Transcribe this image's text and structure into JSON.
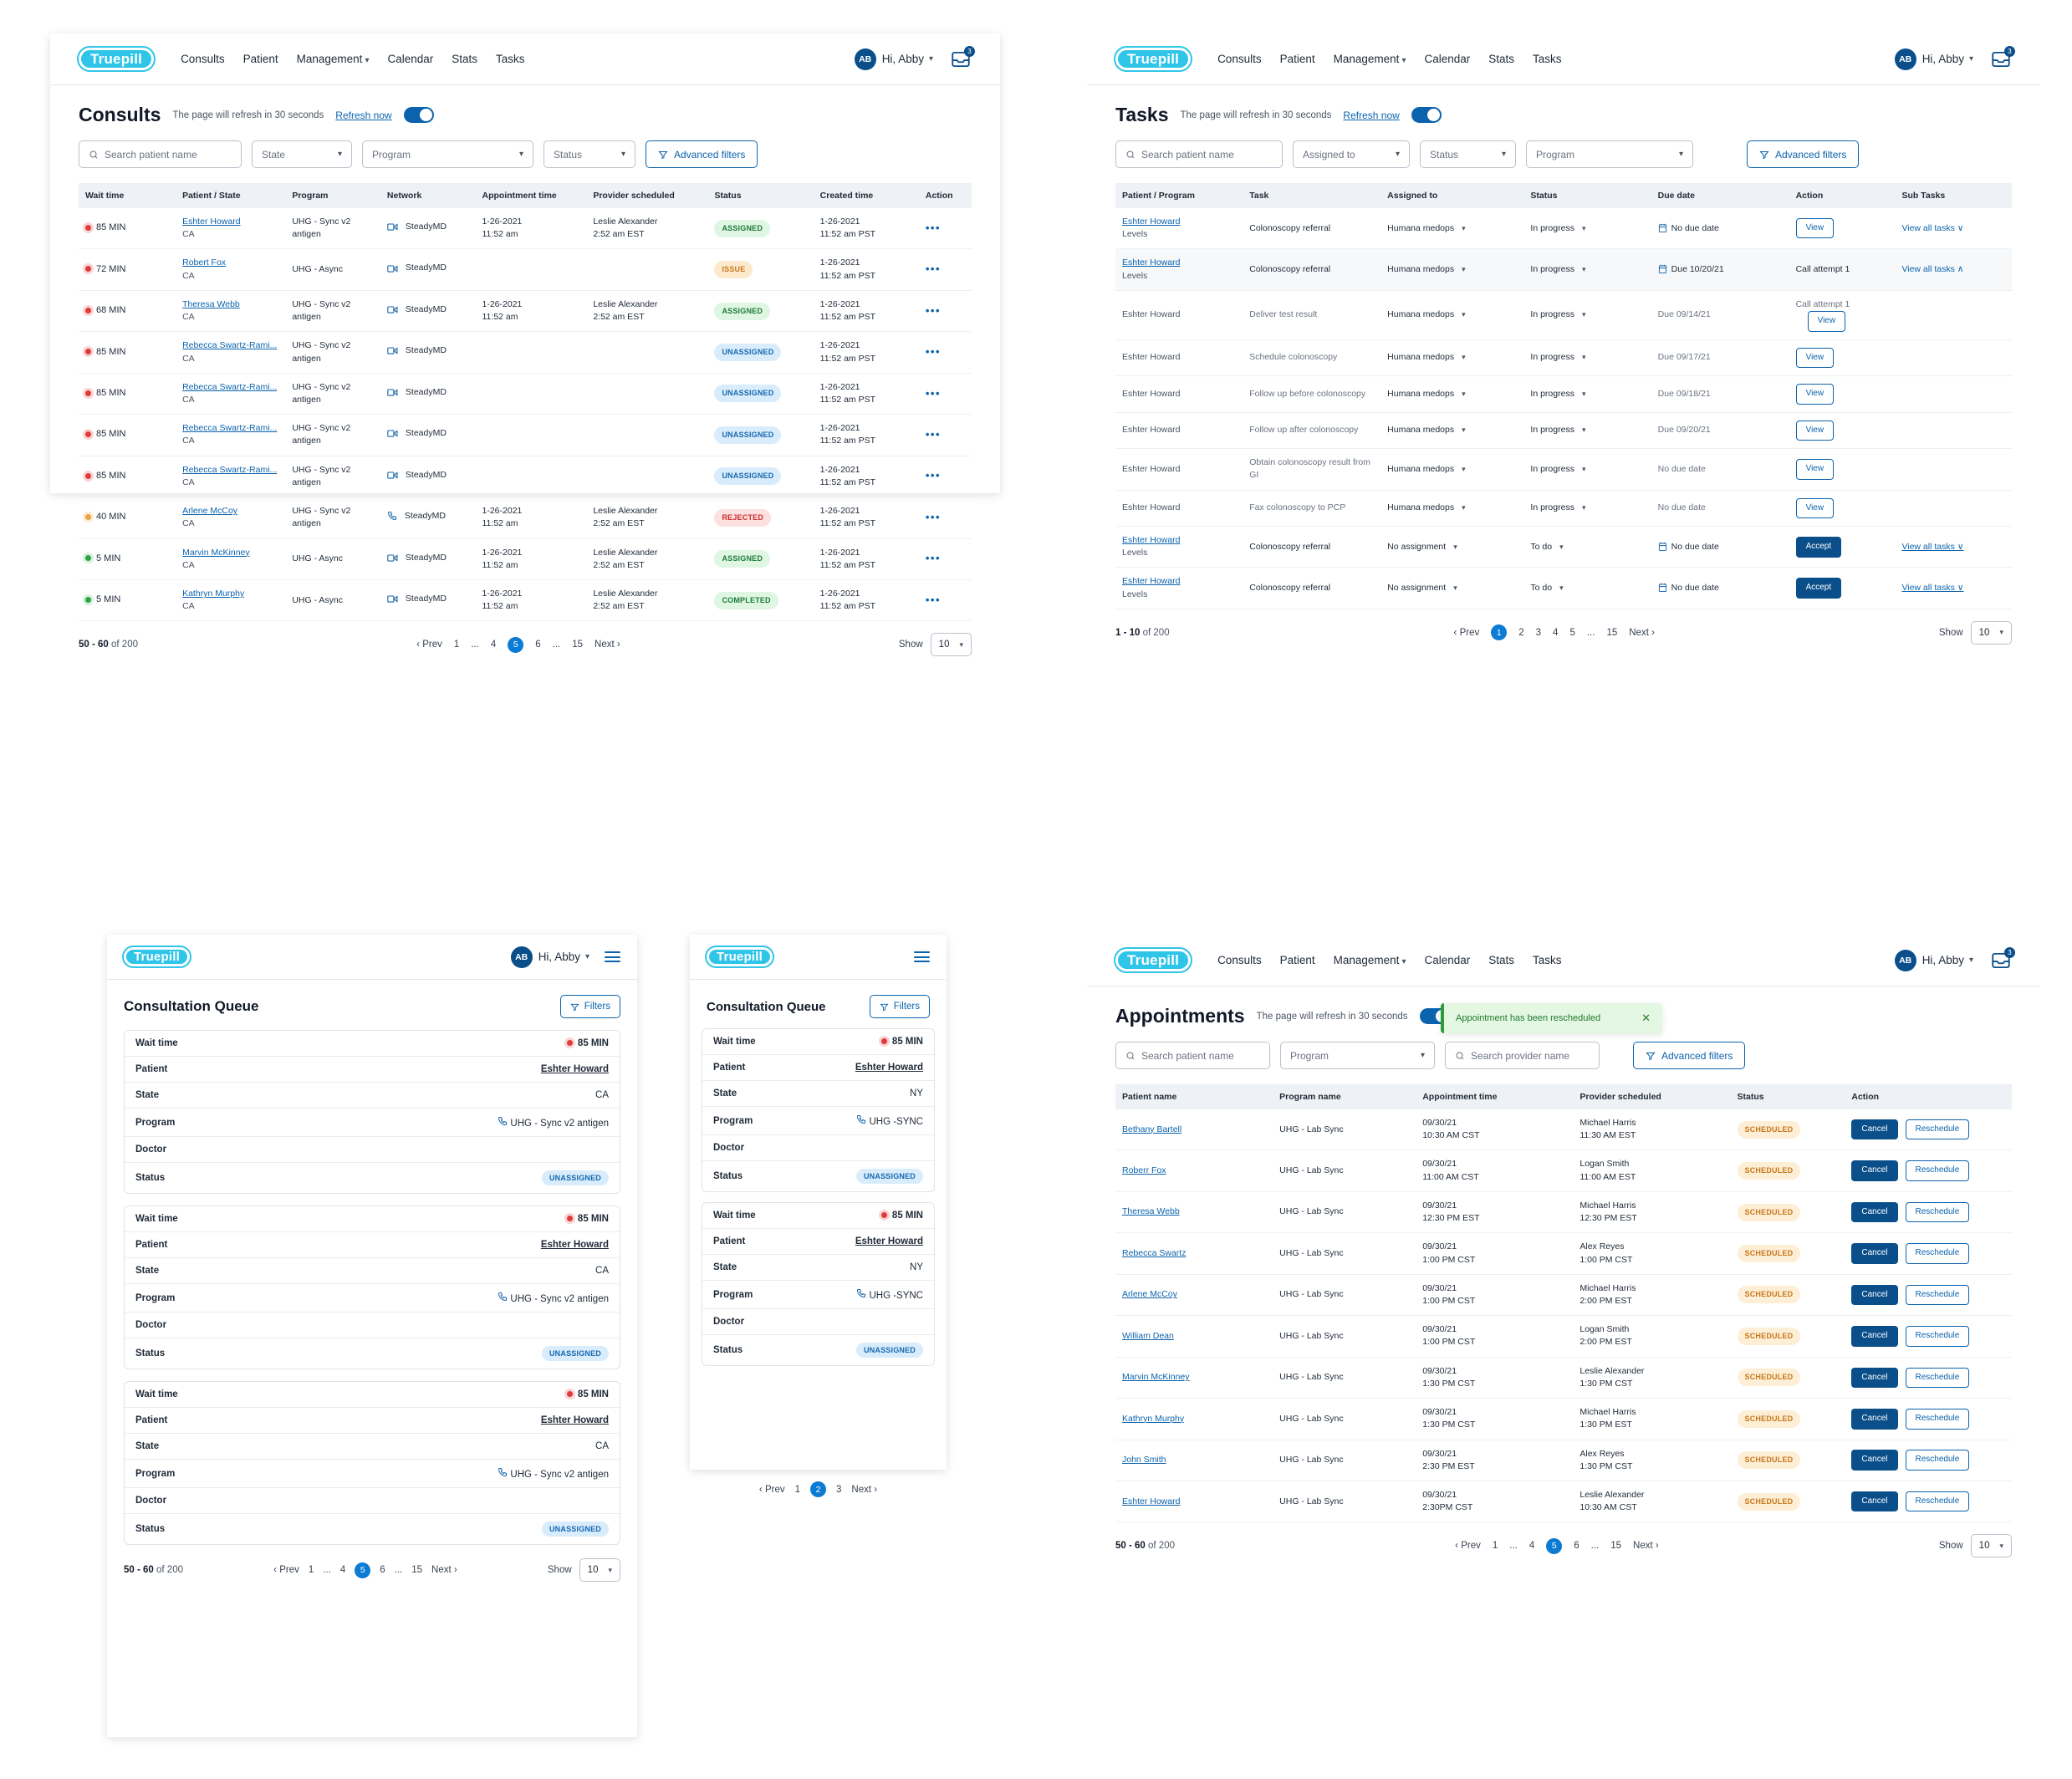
{
  "brand": {
    "logo_text": "Truepill",
    "logo_color": "#2ec5e8"
  },
  "nav": {
    "links": [
      "Consults",
      "Patient",
      "Management",
      "Calendar",
      "Stats",
      "Tasks"
    ],
    "management_has_chevron": true,
    "user_initials": "AB",
    "user_greeting": "Hi, Abby",
    "notification_count": "3"
  },
  "consults": {
    "title": "Consults",
    "refresh_note": "The page will refresh in 30 seconds",
    "refresh_now": "Refresh now",
    "search_placeholder": "Search patient name",
    "filters": [
      "State",
      "Program",
      "Status"
    ],
    "advanced_filters": "Advanced filters",
    "columns": [
      "Wait time",
      "Patient / State",
      "Program",
      "Network",
      "Appointment time",
      "Provider scheduled",
      "Status",
      "Created time",
      "Action"
    ],
    "rows": [
      {
        "wait": "85 MIN",
        "dot": "red",
        "patient": "Eshter Howard",
        "state": "CA",
        "program": "UHG - Sync v2 antigen",
        "media": "video",
        "network": "SteadyMD",
        "appt_date": "1-26-2021",
        "appt_time": "11:52 am",
        "prov_name": "Leslie Alexander",
        "prov_time": "2:52 am EST",
        "status": "ASSIGNED",
        "status_class": "b-assigned",
        "created_date": "1-26-2021",
        "created_time": "11:52 am PST"
      },
      {
        "wait": "72 MIN",
        "dot": "red",
        "patient": "Robert Fox",
        "state": "CA",
        "program": "UHG - Async",
        "media": "video",
        "network": "SteadyMD",
        "appt_date": "",
        "appt_time": "",
        "prov_name": "",
        "prov_time": "",
        "status": "ISSUE",
        "status_class": "b-issue",
        "created_date": "1-26-2021",
        "created_time": "11:52 am PST"
      },
      {
        "wait": "68 MIN",
        "dot": "red",
        "patient": "Theresa Webb",
        "state": "CA",
        "program": "UHG - Sync v2 antigen",
        "media": "video",
        "network": "SteadyMD",
        "appt_date": "1-26-2021",
        "appt_time": "11:52 am",
        "prov_name": "Leslie Alexander",
        "prov_time": "2:52 am EST",
        "status": "ASSIGNED",
        "status_class": "b-assigned",
        "created_date": "1-26-2021",
        "created_time": "11:52 am PST"
      },
      {
        "wait": "85 MIN",
        "dot": "red",
        "patient": "Rebecca Swartz-Rami...",
        "state": "CA",
        "program": "UHG - Sync v2 antigen",
        "media": "video",
        "network": "SteadyMD",
        "appt_date": "",
        "appt_time": "",
        "prov_name": "",
        "prov_time": "",
        "status": "UNASSIGNED",
        "status_class": "b-unassigned",
        "created_date": "1-26-2021",
        "created_time": "11:52 am PST"
      },
      {
        "wait": "85 MIN",
        "dot": "red",
        "patient": "Rebecca Swartz-Rami...",
        "state": "CA",
        "program": "UHG - Sync v2 antigen",
        "media": "video",
        "network": "SteadyMD",
        "appt_date": "",
        "appt_time": "",
        "prov_name": "",
        "prov_time": "",
        "status": "UNASSIGNED",
        "status_class": "b-unassigned",
        "created_date": "1-26-2021",
        "created_time": "11:52 am PST"
      },
      {
        "wait": "85 MIN",
        "dot": "red",
        "patient": "Rebecca Swartz-Rami...",
        "state": "CA",
        "program": "UHG - Sync v2 antigen",
        "media": "video",
        "network": "SteadyMD",
        "appt_date": "",
        "appt_time": "",
        "prov_name": "",
        "prov_time": "",
        "status": "UNASSIGNED",
        "status_class": "b-unassigned",
        "created_date": "1-26-2021",
        "created_time": "11:52 am PST"
      },
      {
        "wait": "85 MIN",
        "dot": "red",
        "patient": "Rebecca Swartz-Rami...",
        "state": "CA",
        "program": "UHG - Sync v2 antigen",
        "media": "video",
        "network": "SteadyMD",
        "appt_date": "",
        "appt_time": "",
        "prov_name": "",
        "prov_time": "",
        "status": "UNASSIGNED",
        "status_class": "b-unassigned",
        "created_date": "1-26-2021",
        "created_time": "11:52 am PST"
      },
      {
        "wait": "40 MIN",
        "dot": "amber",
        "patient": "Arlene McCoy",
        "state": "CA",
        "program": "UHG - Sync v2 antigen",
        "media": "phone",
        "network": "SteadyMD",
        "appt_date": "1-26-2021",
        "appt_time": "11:52 am",
        "prov_name": "Leslie Alexander",
        "prov_time": "2:52 am EST",
        "status": "REJECTED",
        "status_class": "b-rejected",
        "created_date": "1-26-2021",
        "created_time": "11:52 am PST"
      },
      {
        "wait": "5 MIN",
        "dot": "green",
        "patient": "Marvin McKinney",
        "state": "CA",
        "program": "UHG - Async",
        "media": "video",
        "network": "SteadyMD",
        "appt_date": "1-26-2021",
        "appt_time": "11:52 am",
        "prov_name": "Leslie Alexander",
        "prov_time": "2:52 am EST",
        "status": "ASSIGNED",
        "status_class": "b-assigned",
        "created_date": "1-26-2021",
        "created_time": "11:52 am PST"
      },
      {
        "wait": "5 MIN",
        "dot": "green",
        "patient": "Kathryn Murphy",
        "state": "CA",
        "program": "UHG - Async",
        "media": "video",
        "network": "SteadyMD",
        "appt_date": "1-26-2021",
        "appt_time": "11:52 am",
        "prov_name": "Leslie Alexander",
        "prov_time": "2:52 am EST",
        "status": "COMPLETED",
        "status_class": "b-completed",
        "created_date": "1-26-2021",
        "created_time": "11:52 am PST"
      }
    ],
    "pager": {
      "range_bold": "50 - 60",
      "range_rest": "of 200",
      "prev": "Prev",
      "next": "Next",
      "pages": [
        "1",
        "...",
        "4",
        "5",
        "6",
        "...",
        "15"
      ],
      "active": "5",
      "show_label": "Show",
      "show_value": "10"
    }
  },
  "tasks": {
    "title": "Tasks",
    "refresh_note": "The page will refresh in 30 seconds",
    "refresh_now": "Refresh now",
    "search_placeholder": "Search patient name",
    "filters": [
      "Assigned to",
      "Status",
      "Program"
    ],
    "advanced_filters": "Advanced filters",
    "columns": [
      "Patient / Program",
      "Task",
      "Assigned to",
      "Status",
      "Due date",
      "Action",
      "Sub Tasks"
    ],
    "rows": [
      {
        "kind": "main",
        "patient": "Eshter Howard",
        "program": "Levels",
        "task": "Colonoscopy referral",
        "assigned": "Humana medops",
        "status": "In progress",
        "due": "No due date",
        "due_icon": true,
        "action_label": "View",
        "action_type": "outline",
        "note": "",
        "subtasks": "View all tasks",
        "sub_chev": "∨",
        "expanded": false
      },
      {
        "kind": "main",
        "patient": "Eshter Howard",
        "program": "Levels",
        "task": "Colonoscopy referral",
        "assigned": "Humana medops",
        "status": "In progress",
        "due": "Due 10/20/21",
        "due_icon": true,
        "action_label": "",
        "action_type": "none",
        "note": "Call attempt 1",
        "subtasks": "View all tasks",
        "sub_chev": "∧",
        "expanded": true
      },
      {
        "kind": "sub",
        "patient": "Eshter Howard",
        "program": "",
        "task": "Deliver test result",
        "assigned": "Humana medops",
        "status": "In progress",
        "due": "Due 09/14/21",
        "due_icon": false,
        "action_label": "View",
        "action_type": "outline",
        "note": "Call attempt 1",
        "subtasks": "",
        "sub_chev": "",
        "expanded": false
      },
      {
        "kind": "sub",
        "patient": "Eshter Howard",
        "program": "",
        "task": "Schedule colonoscopy",
        "assigned": "Humana medops",
        "status": "In progress",
        "due": "Due 09/17/21",
        "due_icon": false,
        "action_label": "View",
        "action_type": "outline",
        "note": "",
        "subtasks": "",
        "sub_chev": "",
        "expanded": false
      },
      {
        "kind": "sub",
        "patient": "Eshter Howard",
        "program": "",
        "task": "Follow up before colonoscopy",
        "assigned": "Humana medops",
        "status": "In progress",
        "due": "Due 09/18/21",
        "due_icon": false,
        "action_label": "View",
        "action_type": "outline",
        "note": "",
        "subtasks": "",
        "sub_chev": "",
        "expanded": false
      },
      {
        "kind": "sub",
        "patient": "Eshter Howard",
        "program": "",
        "task": "Follow up after colonoscopy",
        "assigned": "Humana medops",
        "status": "In progress",
        "due": "Due 09/20/21",
        "due_icon": false,
        "action_label": "View",
        "action_type": "outline",
        "note": "",
        "subtasks": "",
        "sub_chev": "",
        "expanded": false
      },
      {
        "kind": "sub",
        "patient": "Eshter Howard",
        "program": "",
        "task": "Obtain colonoscopy result from GI",
        "assigned": "Humana medops",
        "status": "In progress",
        "due": "No due date",
        "due_icon": false,
        "action_label": "View",
        "action_type": "outline",
        "note": "",
        "subtasks": "",
        "sub_chev": "",
        "expanded": false
      },
      {
        "kind": "sub",
        "patient": "Eshter Howard",
        "program": "",
        "task": "Fax colonoscopy to PCP",
        "assigned": "Humana medops",
        "status": "In progress",
        "due": "No due date",
        "due_icon": false,
        "action_label": "View",
        "action_type": "outline",
        "note": "",
        "subtasks": "",
        "sub_chev": "",
        "expanded": false
      },
      {
        "kind": "main",
        "patient": "Eshter Howard",
        "program": "Levels",
        "task": "Colonoscopy referral",
        "assigned": "No assignment",
        "status": "To do",
        "due": "No due date",
        "due_icon": true,
        "action_label": "Accept",
        "action_type": "solid",
        "note": "",
        "subtasks": "View all tasks",
        "sub_chev": "∨",
        "expanded": false
      },
      {
        "kind": "main",
        "patient": "Eshter Howard",
        "program": "Levels",
        "task": "Colonoscopy referral",
        "assigned": "No assignment",
        "status": "To do",
        "due": "No due date",
        "due_icon": true,
        "action_label": "Accept",
        "action_type": "solid",
        "note": "",
        "subtasks": "View all tasks",
        "sub_chev": "∨",
        "expanded": false
      }
    ],
    "pager": {
      "range_bold": "1 - 10",
      "range_rest": "of 200",
      "prev": "Prev",
      "next": "Next",
      "pages": [
        "1",
        "2",
        "3",
        "4",
        "5",
        "...",
        "15"
      ],
      "active": "1",
      "show_label": "Show",
      "show_value": "10"
    }
  },
  "mobile_wide": {
    "user_initials": "AB",
    "user_greeting": "Hi, Abby",
    "title": "Consultation Queue",
    "filters_label": "Filters",
    "labels": [
      "Wait time",
      "Patient",
      "State",
      "Program",
      "Doctor",
      "Status"
    ],
    "cards": [
      {
        "wait": "85 MIN",
        "patient": "Eshter Howard",
        "state": "CA",
        "program": "UHG - Sync v2 antigen",
        "doctor": "",
        "status": "UNASSIGNED"
      },
      {
        "wait": "85 MIN",
        "patient": "Eshter Howard",
        "state": "CA",
        "program": "UHG - Sync v2 antigen",
        "doctor": "",
        "status": "UNASSIGNED"
      },
      {
        "wait": "85 MIN",
        "patient": "Eshter Howard",
        "state": "CA",
        "program": "UHG - Sync v2 antigen",
        "doctor": "",
        "status": "UNASSIGNED"
      }
    ],
    "pager": {
      "range_bold": "50 - 60",
      "range_rest": "of 200",
      "prev": "Prev",
      "next": "Next",
      "pages": [
        "1",
        "...",
        "4",
        "5",
        "6",
        "...",
        "15"
      ],
      "active": "5",
      "show_label": "Show",
      "show_value": "10"
    }
  },
  "mobile_narrow": {
    "title": "Consultation Queue",
    "filters_label": "Filters",
    "labels": [
      "Wait time",
      "Patient",
      "State",
      "Program",
      "Doctor",
      "Status"
    ],
    "cards": [
      {
        "wait": "85 MIN",
        "patient": "Eshter Howard",
        "state": "NY",
        "program": "UHG -SYNC",
        "doctor": "",
        "status": "UNASSIGNED"
      },
      {
        "wait": "85 MIN",
        "patient": "Eshter Howard",
        "state": "NY",
        "program": "UHG -SYNC",
        "doctor": "",
        "status": "UNASSIGNED"
      }
    ],
    "pager": {
      "prev": "Prev",
      "next": "Next",
      "pages": [
        "1",
        "2",
        "3"
      ],
      "active": "2"
    }
  },
  "appointments": {
    "title": "Appointments",
    "refresh_note": "The page will refresh in 30 seconds",
    "toast": "Appointment has been rescheduled",
    "search_patient_placeholder": "Search patient name",
    "program_placeholder": "Program",
    "search_provider_placeholder": "Search provider name",
    "advanced_filters": "Advanced filters",
    "columns": [
      "Patient name",
      "Program name",
      "Appointment time",
      "Provider scheduled",
      "Status",
      "Action"
    ],
    "cancel_label": "Cancel",
    "reschedule_label": "Reschedule",
    "rows": [
      {
        "patient": "Bethany Bartell",
        "program": "UHG - Lab Sync",
        "appt_date": "09/30/21",
        "appt_time": "10:30 AM CST",
        "prov_name": "Michael Harris",
        "prov_time": "11:30 AM EST",
        "status": "SCHEDULED"
      },
      {
        "patient": "Roberr Fox",
        "program": "UHG - Lab Sync",
        "appt_date": "09/30/21",
        "appt_time": "11:00 AM CST",
        "prov_name": "Logan Smith",
        "prov_time": "11:00 AM EST",
        "status": "SCHEDULED"
      },
      {
        "patient": "Theresa Webb",
        "program": "UHG - Lab Sync",
        "appt_date": "09/30/21",
        "appt_time": "12:30 PM EST",
        "prov_name": "Michael Harris",
        "prov_time": "12:30 PM EST",
        "status": "SCHEDULED"
      },
      {
        "patient": "Rebecca Swartz",
        "program": "UHG - Lab Sync",
        "appt_date": "09/30/21",
        "appt_time": "1:00 PM CST",
        "prov_name": "Alex Reyes",
        "prov_time": "1:00 PM CST",
        "status": "SCHEDULED"
      },
      {
        "patient": "Arlene McCoy",
        "program": "UHG - Lab Sync",
        "appt_date": "09/30/21",
        "appt_time": "1:00 PM CST",
        "prov_name": "Michael Harris",
        "prov_time": "2:00 PM EST",
        "status": "SCHEDULED"
      },
      {
        "patient": "William Dean",
        "program": "UHG - Lab Sync",
        "appt_date": "09/30/21",
        "appt_time": "1:00 PM CST",
        "prov_name": "Logan Smith",
        "prov_time": "2:00 PM EST",
        "status": "SCHEDULED"
      },
      {
        "patient": "Marvin McKinney",
        "program": "UHG - Lab Sync",
        "appt_date": "09/30/21",
        "appt_time": "1:30 PM CST",
        "prov_name": "Leslie Alexander",
        "prov_time": "1:30 PM CST",
        "status": "SCHEDULED"
      },
      {
        "patient": "Kathryn Murphy",
        "program": "UHG - Lab Sync",
        "appt_date": "09/30/21",
        "appt_time": "1:30 PM CST",
        "prov_name": "Michael Harris",
        "prov_time": "1:30 PM EST",
        "status": "SCHEDULED"
      },
      {
        "patient": "John Smith",
        "program": "UHG - Lab Sync",
        "appt_date": "09/30/21",
        "appt_time": "2:30 PM EST",
        "prov_name": "Alex Reyes",
        "prov_time": "1:30 PM CST",
        "status": "SCHEDULED"
      },
      {
        "patient": "Eshter Howard",
        "program": "UHG - Lab Sync",
        "appt_date": "09/30/21",
        "appt_time": "2:30PM CST",
        "prov_name": "Leslie Alexander",
        "prov_time": "10:30 AM CST",
        "status": "SCHEDULED"
      }
    ],
    "pager": {
      "range_bold": "50 - 60",
      "range_rest": "of 200",
      "prev": "Prev",
      "next": "Next",
      "pages": [
        "1",
        "...",
        "4",
        "5",
        "6",
        "...",
        "15"
      ],
      "active": "5",
      "show_label": "Show",
      "show_value": "10"
    }
  }
}
